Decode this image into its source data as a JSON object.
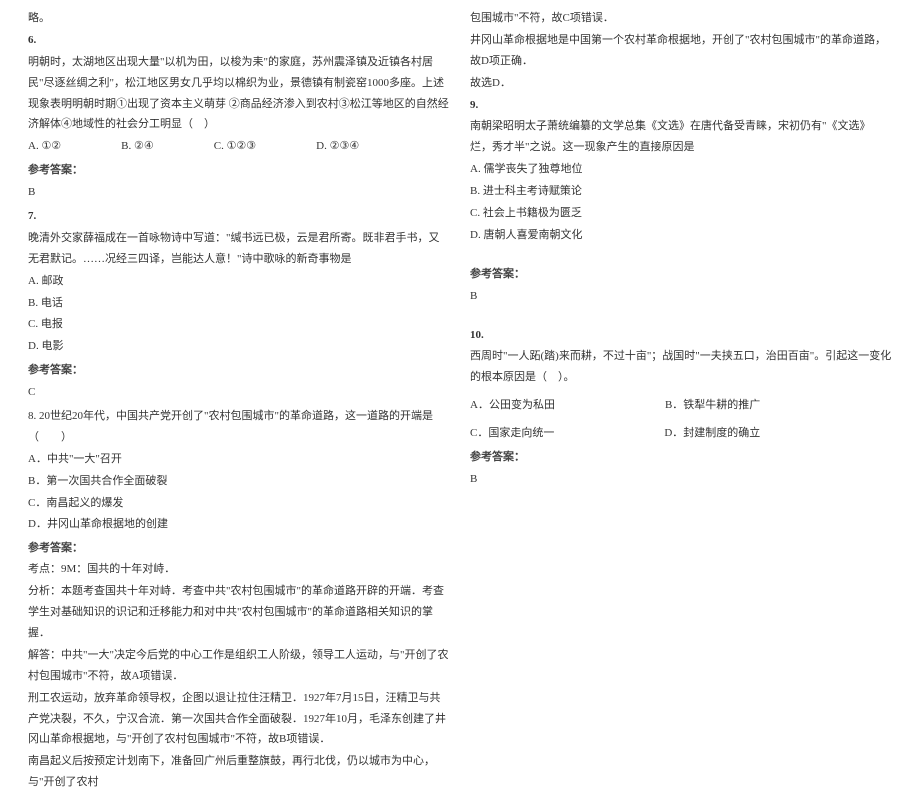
{
  "left": {
    "top_note": "略。",
    "q6": {
      "num": "6.",
      "text1": "明朝时，太湖地区出现大量\"以机为田，以梭为耒\"的家庭，苏州震泽镇及近镇各村居民\"尽逐丝绸之利\"，松江地区男女几乎均以棉织为业，景德镇有制瓷窑1000多座。上述现象表明明朝时期①出现了资本主义萌芽 ②商品经济渗入到农村③松江等地区的自然经济解体④地域性的社会分工明显（　）",
      "optA": "A. ①②",
      "optB": "B. ②④",
      "optC": "C. ①②③",
      "optD": "D. ②③④",
      "ans_label": "参考答案：",
      "ans": "B"
    },
    "q7": {
      "num": "7.",
      "text1": "晚清外交家薛福成在一首咏物诗中写道：\"缄书远已极，云是君所寄。既非君手书，又无君默记。……况经三四译，岂能达人意！\"诗中歌咏的新奇事物是",
      "optA": "A. 邮政",
      "optB": "B. 电话",
      "optC": "C. 电报",
      "optD": "D. 电影",
      "ans_label": "参考答案：",
      "ans": "C"
    },
    "q8": {
      "num_text": "8. 20世纪20年代，中国共产党开创了\"农村包围城市\"的革命道路，这一道路的开端是（　　）",
      "optA": "A．中共\"一大\"召开",
      "optB": "B．第一次国共合作全面破裂",
      "optC": "C．南昌起义的爆发",
      "optD": "D．井冈山革命根据地的创建",
      "ans_label": "参考答案：",
      "exam_point": "考点：9M：国共的十年对峙．",
      "analysis": "分析：本题考查国共十年对峙．考查中共\"农村包围城市\"的革命道路开辟的开端．考查学生对基础知识的识记和迁移能力和对中共\"农村包围城市\"的革命道路相关知识的掌握．",
      "explain1": "解答：中共\"一大\"决定今后党的中心工作是组织工人阶级，领导工人运动，与\"开创了农村包围城市\"不符，故A项错误．",
      "explain2": "刑工农运动，放弃革命领导权，企图以退让拉住汪精卫．1927年7月15日，汪精卫与共产党决裂，不久，宁汉合流．第一次国共合作全面破裂．1927年10月，毛泽东创建了井冈山革命根据地，与\"开创了农村包围城市\"不符，故B项错误．",
      "explain3": "南昌起义后按预定计划南下，准备回广州后重整旗鼓，再行北伐，仍以城市为中心，与\"开创了农村"
    }
  },
  "right": {
    "q8_cont": {
      "line1": "包围城市\"不符，故C项错误．",
      "line2": "井冈山革命根据地是中国第一个农村革命根据地，开创了\"农村包围城市\"的革命道路，故D项正确．",
      "line3": "故选D．"
    },
    "q9": {
      "num": "9.",
      "text": "南朝梁昭明太子萧统编纂的文学总集《文选》在唐代备受青睐，宋初仍有\"《文选》烂，秀才半\"之说。这一现象产生的直接原因是",
      "optA": "A. 儒学丧失了独尊地位",
      "optB": "B. 进士科主考诗赋策论",
      "optC": "C. 社会上书籍极为匮乏",
      "optD": "D. 唐朝人喜爱南朝文化",
      "ans_label": "参考答案：",
      "ans": "B"
    },
    "wm1": "",
    "wm2": "",
    "q10": {
      "num": "10.",
      "text": "西周时\"一人跖(踏)来而耕，不过十亩\"；战国时\"一夫挟五口，治田百亩\"。引起这一变化的根本原因是（　）。",
      "optA": "A．公田变为私田",
      "optB": "B．铁犁牛耕的推广",
      "optC": "C．国家走向统一",
      "optD": "D．封建制度的确立",
      "ans_label": "参考答案：",
      "ans": "B"
    }
  }
}
